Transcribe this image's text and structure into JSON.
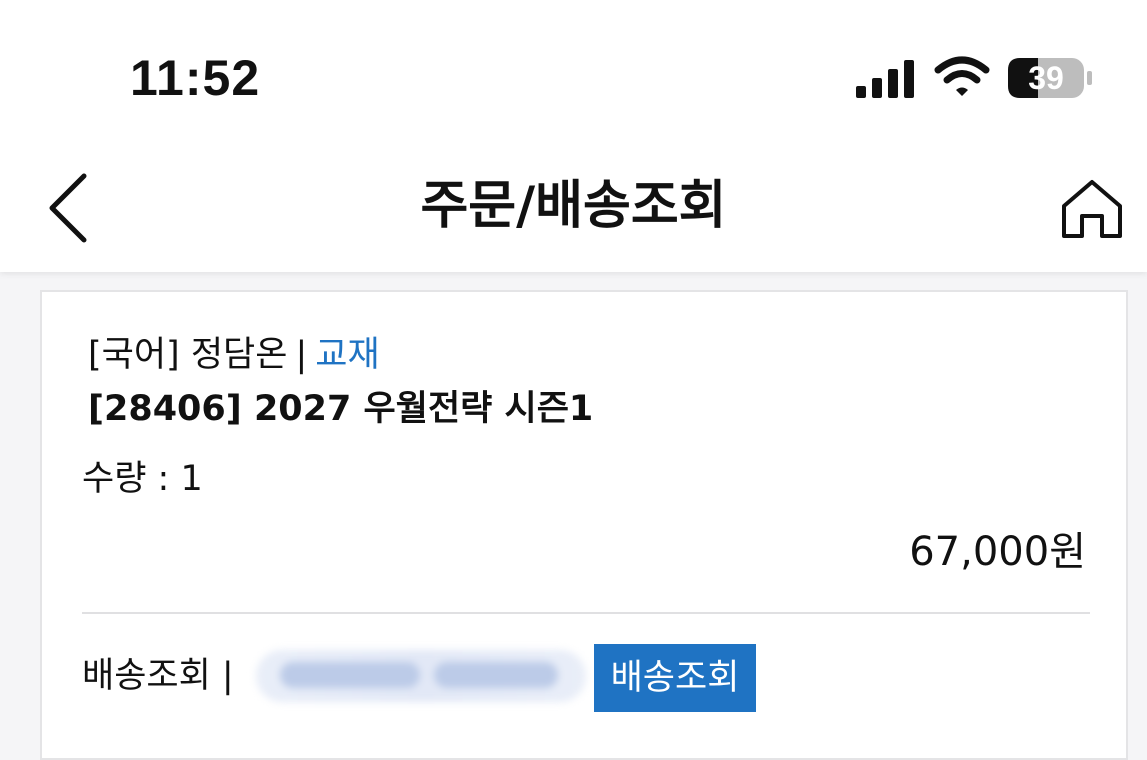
{
  "status_bar": {
    "time": "11:52",
    "battery": "39"
  },
  "header": {
    "title": "주문/배송조회"
  },
  "order_item": {
    "subject": "[국어]",
    "teacher": "정담온",
    "separator": "|",
    "type": "교재",
    "title": "[28406] 2027 우월전략 시즌1",
    "quantity": "수량 : 1",
    "price": "67,000원",
    "shipping_label": "배송조회 |",
    "track_button": "배송조회"
  },
  "colors": {
    "accent": "#1f73c3",
    "background": "#f5f5f7",
    "card": "#ffffff"
  }
}
